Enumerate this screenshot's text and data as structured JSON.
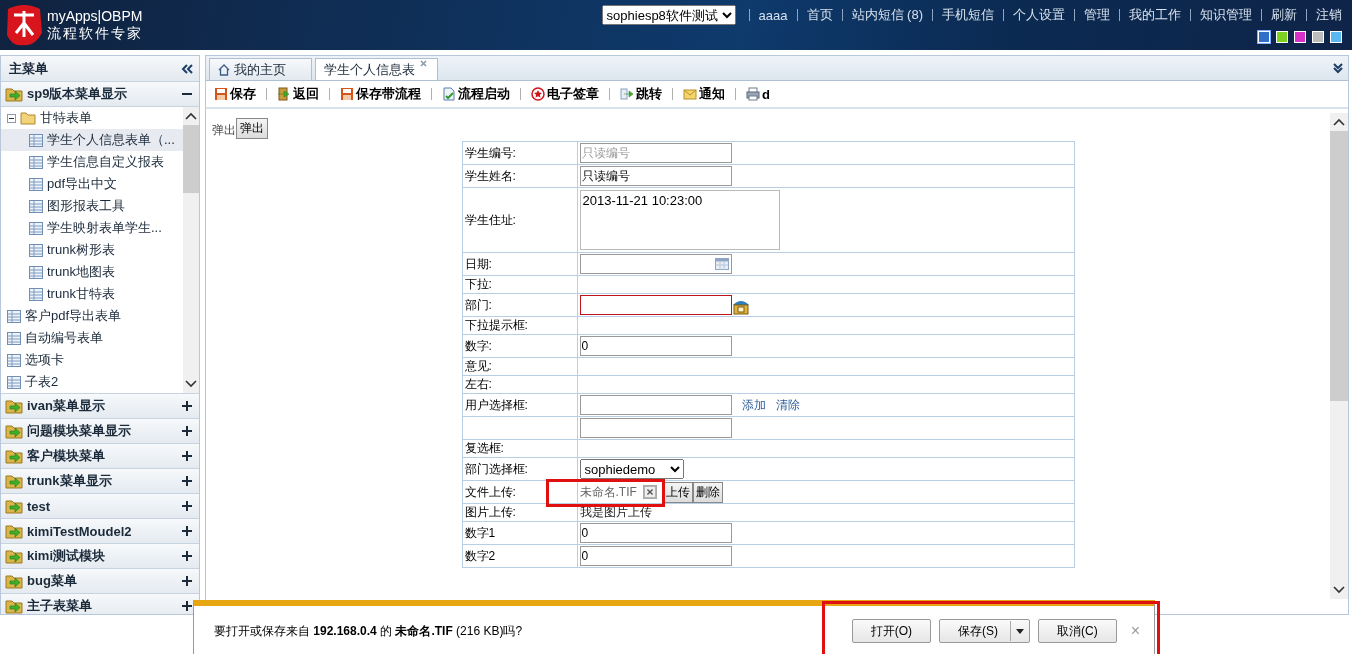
{
  "header": {
    "logo_title": "myApps|OBPM",
    "logo_subtitle": "流程软件专家",
    "app_select": {
      "value": "sophiesp8软件测试"
    },
    "nav": [
      "aaaa",
      "首页",
      "站内短信 (8)",
      "手机短信",
      "个人设置",
      "管理",
      "我的工作",
      "知识管理",
      "刷新",
      "注销"
    ],
    "themes": [
      {
        "color": "#2f6fc8",
        "selected": true
      },
      {
        "color": "#7ed321",
        "selected": false
      },
      {
        "color": "#d930c8",
        "selected": false
      },
      {
        "color": "#bdbdbd",
        "selected": false
      },
      {
        "color": "#5ab8f0",
        "selected": false
      }
    ]
  },
  "sidebar": {
    "title": "主菜单",
    "groups": [
      {
        "label": "sp9版本菜单显示",
        "expanded": true,
        "children": [
          {
            "label": "甘特表单",
            "kind": "folder",
            "expanded": true,
            "selected": false,
            "children": [
              {
                "label": "学生个人信息表单（...",
                "kind": "form",
                "selected": true
              },
              {
                "label": "学生信息自定义报表",
                "kind": "form",
                "selected": false
              },
              {
                "label": "pdf导出中文",
                "kind": "form",
                "selected": false
              },
              {
                "label": "图形报表工具",
                "kind": "form",
                "selected": false
              },
              {
                "label": "学生映射表单学生...",
                "kind": "form",
                "selected": false
              },
              {
                "label": "trunk树形表",
                "kind": "form",
                "selected": false
              },
              {
                "label": "trunk地图表",
                "kind": "form",
                "selected": false
              },
              {
                "label": "trunk甘特表",
                "kind": "form",
                "selected": false
              }
            ]
          },
          {
            "label": "客户pdf导出表单",
            "kind": "form",
            "selected": false
          },
          {
            "label": "自动编号表单",
            "kind": "form",
            "selected": false
          },
          {
            "label": "选项卡",
            "kind": "form",
            "selected": false
          },
          {
            "label": "子表2",
            "kind": "form",
            "selected": false
          }
        ]
      },
      {
        "label": "ivan菜单显示",
        "expanded": false
      },
      {
        "label": "问题模块菜单显示",
        "expanded": false
      },
      {
        "label": "客户模块菜单",
        "expanded": false
      },
      {
        "label": "trunk菜单显示",
        "expanded": false
      },
      {
        "label": "test",
        "expanded": false
      },
      {
        "label": "kimiTestMoudel2",
        "expanded": false
      },
      {
        "label": "kimi测试模块",
        "expanded": false
      },
      {
        "label": "bug菜单",
        "expanded": false
      },
      {
        "label": "主子表菜单",
        "expanded": false
      }
    ]
  },
  "tabs": [
    {
      "label": "我的主页",
      "kind": "home",
      "selected": false
    },
    {
      "label": "学生个人信息表",
      "kind": "form",
      "selected": true
    }
  ],
  "toolbar": [
    {
      "label": "保存",
      "kind": "save"
    },
    {
      "label": "返回",
      "kind": "back"
    },
    {
      "label": "保存带流程",
      "kind": "save"
    },
    {
      "label": "流程启动",
      "kind": "flow"
    },
    {
      "label": "电子签章",
      "kind": "seal"
    },
    {
      "label": "跳转",
      "kind": "jump"
    },
    {
      "label": "通知",
      "kind": "mail"
    },
    {
      "label": "d",
      "kind": "print"
    }
  ],
  "content": {
    "popup_label": "弹出",
    "popup_button": "弹出",
    "rows": [
      {
        "label": "学生编号:",
        "kind": "text",
        "value": "只读编号",
        "readonly": true
      },
      {
        "label": "学生姓名:",
        "kind": "text",
        "value": "只读编号",
        "readonly": false
      },
      {
        "label": "学生住址:",
        "kind": "textarea",
        "value": "2013-11-21 10:23:00"
      },
      {
        "label": "日期:",
        "kind": "date"
      },
      {
        "label": "下拉:",
        "kind": "empty"
      },
      {
        "label": "部门:",
        "kind": "dept",
        "invalid": true
      },
      {
        "label": "下拉提示框:",
        "kind": "empty"
      },
      {
        "label": "数字:",
        "kind": "text",
        "value": "0",
        "readonly": false
      },
      {
        "label": "意见:",
        "kind": "empty"
      },
      {
        "label": "左右:",
        "kind": "empty"
      },
      {
        "label": "用户选择框:",
        "kind": "user",
        "links": [
          "添加",
          "清除"
        ]
      },
      {
        "kind": "text"
      },
      {
        "label": "复选框:",
        "kind": "empty"
      },
      {
        "label": "部门选择框:",
        "kind": "select",
        "value": "sophiedemo"
      },
      {
        "label": "文件上传:",
        "kind": "file",
        "file_name": "未命名.TIF",
        "buttons": [
          "上传",
          "删除"
        ],
        "highlighted": true
      },
      {
        "label": "图片上传:",
        "kind": "note",
        "value": "我是图片上传"
      },
      {
        "label": "数字1",
        "kind": "text",
        "value": "0",
        "readonly": false
      },
      {
        "label": "数字2",
        "kind": "text",
        "value": "0",
        "readonly": false
      }
    ]
  },
  "download_bar": {
    "message": "要打开或保存来自 **192.168.0.4** 的 **未命名.TIF** (216 KB)吗?",
    "highlighted": true,
    "buttons": [
      {
        "label": "打开(O)",
        "dropdown": false
      },
      {
        "label": "保存(S)",
        "dropdown": true
      },
      {
        "label": "取消(C)",
        "dropdown": false
      }
    ],
    "close": "×"
  }
}
